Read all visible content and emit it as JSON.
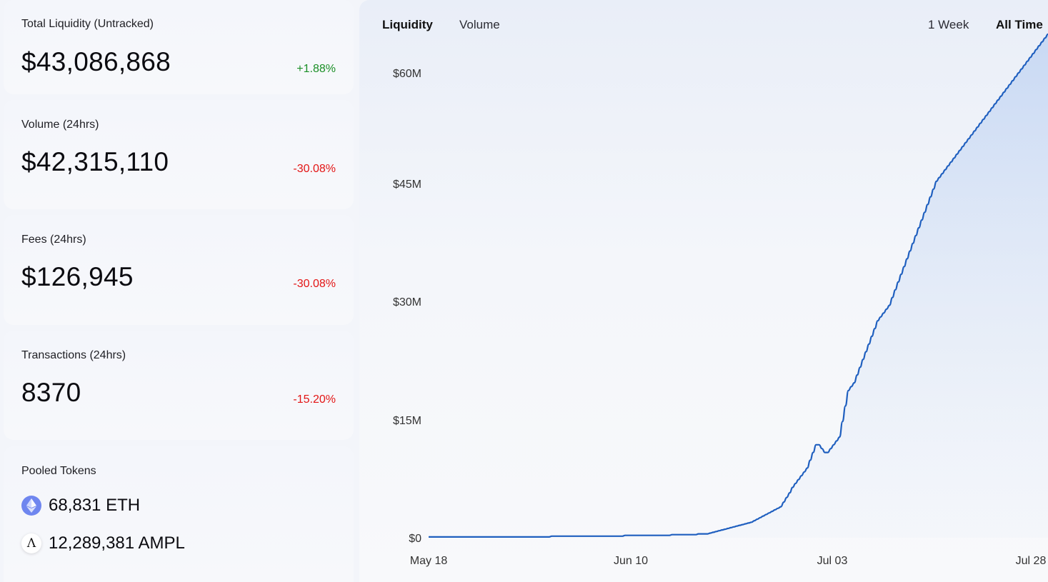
{
  "stats": [
    {
      "label": "Total Liquidity (Untracked)",
      "value": "$43,086,868",
      "delta": "+1.88%",
      "trend": "up"
    },
    {
      "label": "Volume (24hrs)",
      "value": "$42,315,110",
      "delta": "-30.08%",
      "trend": "down"
    },
    {
      "label": "Fees (24hrs)",
      "value": "$126,945",
      "delta": "-30.08%",
      "trend": "down"
    },
    {
      "label": "Transactions (24hrs)",
      "value": "8370",
      "delta": "-15.20%",
      "trend": "down"
    }
  ],
  "pooled": {
    "title": "Pooled Tokens",
    "tokens": [
      {
        "amount": "68,831 ETH",
        "icon": "eth-icon"
      },
      {
        "amount": "12,289,381 AMPL",
        "icon": "ampl-icon",
        "glyph": "Λ"
      }
    ]
  },
  "chart": {
    "tabs": {
      "liquidity": "Liquidity",
      "volume": "Volume"
    },
    "ranges": {
      "week": "1 Week",
      "all": "All Time"
    },
    "active_tab": "Liquidity",
    "active_range": "All Time"
  },
  "colors": {
    "line": "#1f5fbf",
    "positive": "#1a8f26",
    "negative": "#e31515",
    "eth": "#6f86ef"
  },
  "chart_data": {
    "type": "area",
    "series": [
      {
        "name": "Liquidity",
        "values": [
          0.1,
          0.1,
          0.1,
          0.1,
          0.1,
          0.1,
          0.1,
          0.1,
          0.1,
          0.1,
          0.1,
          0.1,
          0.1,
          0.1,
          0.1,
          0.1,
          0.1,
          0.1,
          0.1,
          0.1,
          0.1,
          0.1,
          0.1,
          0.1,
          0.1,
          0.1,
          0.1,
          0.1,
          0.1,
          0.1,
          0.1,
          0.1,
          0.1,
          0.1,
          0.1,
          0.1,
          0.1,
          0.1,
          0.1,
          0.1,
          0.1,
          0.1,
          0.2,
          0.2,
          0.2,
          0.2,
          0.2,
          0.2,
          0.2,
          0.2,
          0.2,
          0.2,
          0.2,
          0.2,
          0.2,
          0.2,
          0.2,
          0.2,
          0.2,
          0.2,
          0.2,
          0.2,
          0.2,
          0.2,
          0.2,
          0.2,
          0.2,
          0.3,
          0.3,
          0.3,
          0.3,
          0.3,
          0.3,
          0.3,
          0.3,
          0.3,
          0.3,
          0.3,
          0.3,
          0.3,
          0.3,
          0.3,
          0.3,
          0.4,
          0.4,
          0.4,
          0.4,
          0.4,
          0.4,
          0.4,
          0.4,
          0.4,
          0.5,
          0.5,
          0.5,
          0.5,
          0.6,
          0.7,
          0.8,
          0.9,
          1.0,
          1.1,
          1.2,
          1.3,
          1.4,
          1.5,
          1.6,
          1.7,
          1.8,
          1.9,
          2.0,
          2.2,
          2.4,
          2.6,
          2.8,
          3.0,
          3.2,
          3.4,
          3.6,
          3.8,
          4.0,
          4.6,
          5.2,
          5.8,
          6.5,
          7.0,
          7.5,
          8.0,
          8.5,
          9.0,
          10.0,
          11.0,
          12.0,
          12.0,
          11.5,
          11.0,
          11.0,
          11.5,
          12.0,
          12.5,
          13.0,
          15.0,
          17.0,
          19.0,
          19.5,
          20.0,
          21.0,
          22.0,
          23.0,
          24.0,
          25.0,
          26.0,
          27.0,
          28.0,
          28.5,
          29.0,
          29.5,
          30.0,
          31.0,
          32.0,
          33.0,
          34.0,
          35.0,
          36.0,
          37.0,
          38.0,
          39.0,
          40.0,
          41.0,
          42.0,
          43.0,
          44.0,
          45.0,
          46.0,
          46.5,
          47.0,
          47.5,
          48.0,
          48.5,
          49.0,
          49.5,
          50.0,
          50.5,
          51.0,
          51.5,
          52.0,
          52.5,
          53.0,
          53.5,
          54.0,
          54.5,
          55.0,
          55.5,
          56.0,
          56.5,
          57.0,
          57.5,
          58.0,
          58.5,
          59.0,
          59.5,
          60.0,
          60.5,
          61.0,
          61.5,
          62.0,
          62.5,
          63.0,
          63.5,
          64.0,
          64.5,
          65.0
        ]
      }
    ],
    "x_tick_labels": [
      "May 18",
      "Jun 10",
      "Jul 03",
      "Jul 28"
    ],
    "y_tick_labels": [
      "$0",
      "$15M",
      "$30M",
      "$45M",
      "$60M"
    ],
    "ylim": [
      0,
      60
    ]
  }
}
